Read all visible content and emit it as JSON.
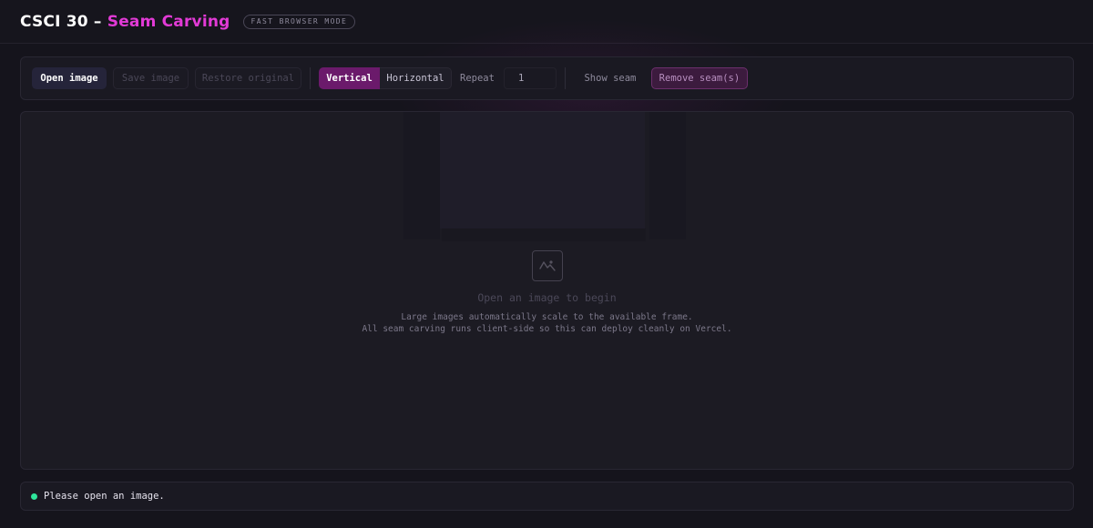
{
  "header": {
    "title_prefix": "CSCI 30 – ",
    "title_accent": "Seam Carving",
    "mode_badge": "FAST BROWSER MODE"
  },
  "toolbar": {
    "open_label": "Open image",
    "save_label": "Save image",
    "restore_label": "Restore original",
    "direction": {
      "options": [
        "Vertical",
        "Horizontal"
      ],
      "selected": "Vertical"
    },
    "repeat_label": "Repeat",
    "repeat_value": "1",
    "show_seam_label": "Show seam",
    "remove_label": "Remove seam(s)"
  },
  "canvas": {
    "icon": "image-icon",
    "title": "Open an image to begin",
    "line1": "Large images automatically scale to the available frame.",
    "line2": "All seam carving runs client-side so this can deploy cleanly on Vercel."
  },
  "status": {
    "text": "Please open an image.",
    "color": "#2ee59b"
  },
  "colors": {
    "accent": "#e23ad6",
    "selected": "#6b1a6b",
    "background": "#15141c"
  }
}
